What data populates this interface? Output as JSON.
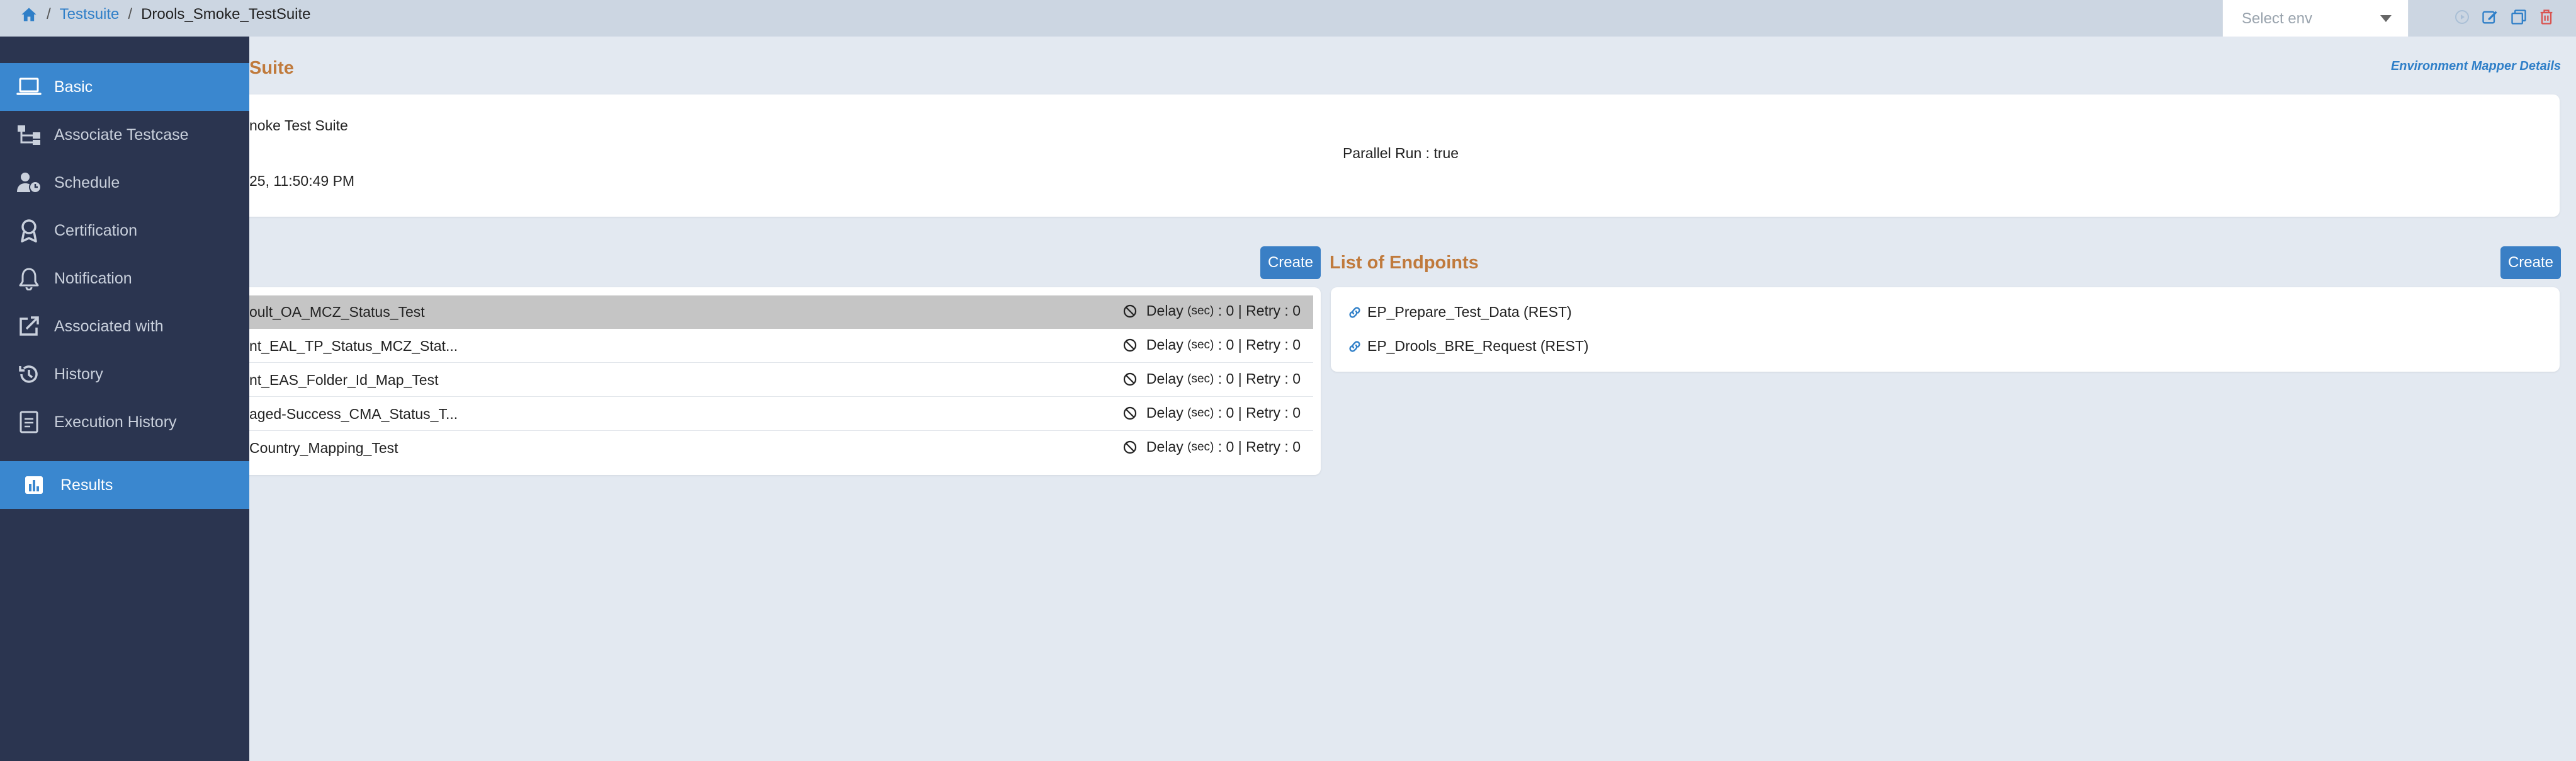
{
  "breadcrumb": {
    "root": "Testsuite",
    "current": "Drools_Smoke_TestSuite"
  },
  "env_select": {
    "placeholder": "Select env"
  },
  "sidebar": {
    "items": [
      {
        "label": "Basic",
        "icon": "laptop-icon",
        "active": true
      },
      {
        "label": "Associate Testcase",
        "icon": "hierarchy-icon"
      },
      {
        "label": "Schedule",
        "icon": "user-clock-icon"
      },
      {
        "label": "Certification",
        "icon": "award-icon"
      },
      {
        "label": "Notification",
        "icon": "bell-icon"
      },
      {
        "label": "Associated with",
        "icon": "external-link-icon"
      },
      {
        "label": "History",
        "icon": "history-icon"
      },
      {
        "label": "Execution History",
        "icon": "document-icon"
      },
      {
        "label": "Results",
        "icon": "bar-chart-icon",
        "active": true
      }
    ]
  },
  "suite": {
    "title_fragment": "Suite",
    "env_mapper_link": "Environment Mapper Details",
    "name_fragment": "noke Test Suite",
    "date_fragment": "25, 11:50:49 PM",
    "parallel_run": "Parallel Run : true"
  },
  "testcases": {
    "create_label": "Create",
    "rows": [
      {
        "name": "oult_OA_MCZ_Status_Test",
        "selected": true
      },
      {
        "name": "nt_EAL_TP_Status_MCZ_Stat..."
      },
      {
        "name": "nt_EAS_Folder_Id_Map_Test"
      },
      {
        "name": "aged-Success_CMA_Status_T..."
      },
      {
        "name": "Country_Mapping_Test"
      }
    ],
    "delay_label": "Delay",
    "delay_unit": "(sec)",
    "delay_value": ": 0",
    "retry_text": "| Retry : 0"
  },
  "endpoints": {
    "title": "List of Endpoints",
    "create_label": "Create",
    "items": [
      {
        "label": "EP_Prepare_Test_Data (REST)"
      },
      {
        "label": "EP_Drools_BRE_Request (REST)"
      }
    ]
  },
  "colors": {
    "accent": "#3a87cf",
    "sidebar": "#2b3550",
    "title": "#c07a3c",
    "link": "#2f7fc8"
  }
}
